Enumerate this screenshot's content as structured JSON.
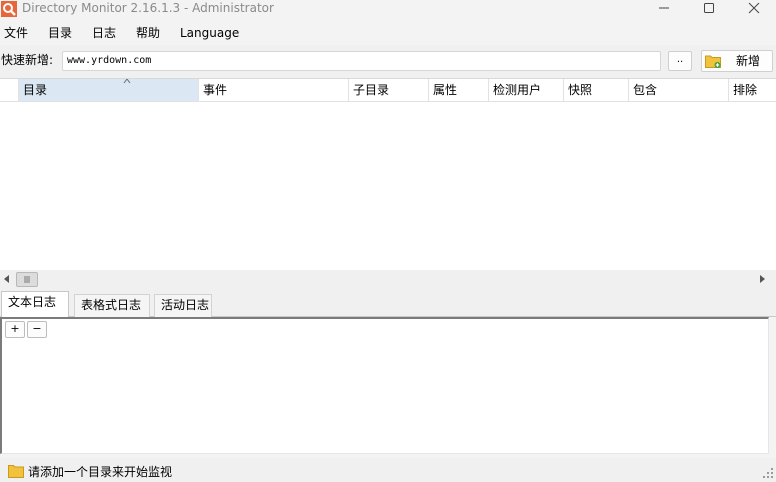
{
  "app": {
    "title": "Directory Monitor 2.16.1.3 - Administrator",
    "accent_color": "#e8673a"
  },
  "window_controls": [
    "minimize-icon",
    "maximize-icon",
    "close-icon"
  ],
  "menu": {
    "items": [
      "文件",
      "目录",
      "日志",
      "帮助",
      "Language"
    ]
  },
  "quick_add": {
    "label": "快速新增:",
    "value": "www.yrdown.com",
    "browse_label": "..",
    "add_label": "新增"
  },
  "grid": {
    "columns": [
      "目录",
      "事件",
      "子目录",
      "属性",
      "检测用户",
      "快照",
      "包含",
      "排除"
    ],
    "sorted_column": "目录",
    "rows": []
  },
  "log": {
    "tabs": [
      "文本日志",
      "表格式日志",
      "活动日志"
    ],
    "active_tab": "文本日志",
    "expand_label": "+",
    "collapse_label": "−"
  },
  "status": {
    "text": "请添加一个目录来开始监视"
  }
}
